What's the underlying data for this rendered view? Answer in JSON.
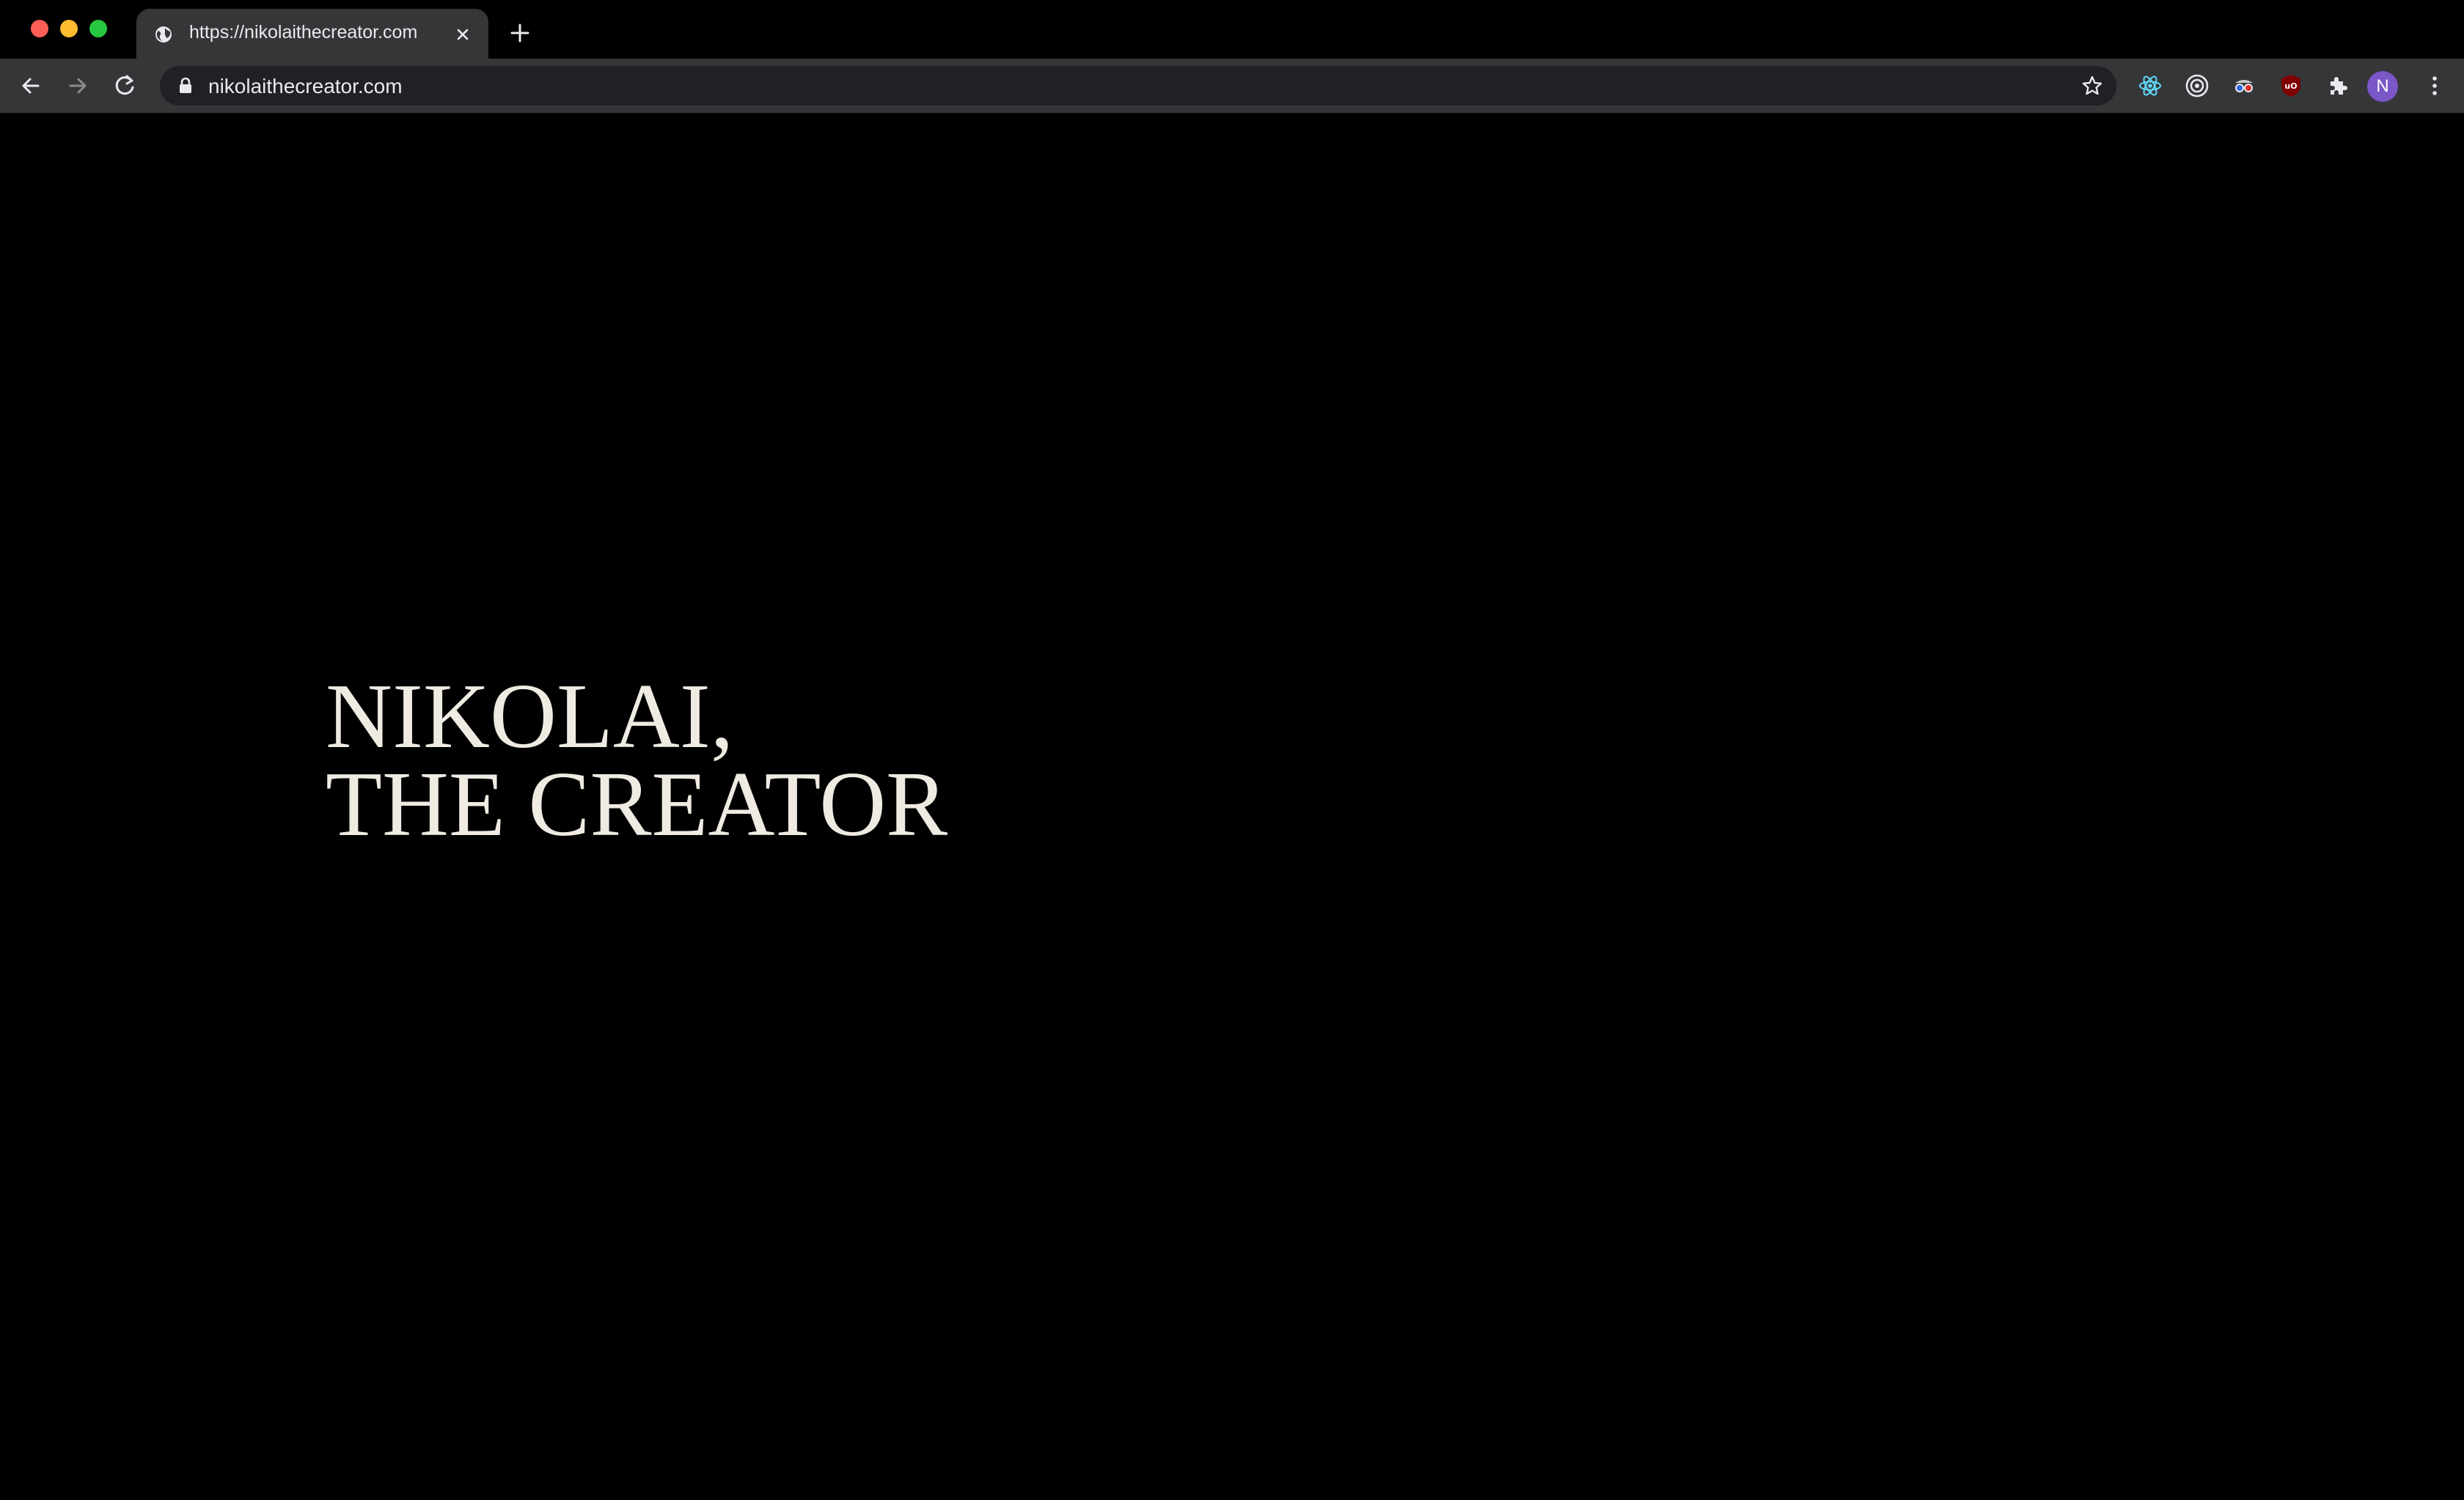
{
  "browser": {
    "tab": {
      "title": "https://nikolaithecreator.com"
    },
    "omnibox": {
      "url": "nikolaithecreator.com"
    },
    "profile": {
      "initial": "N",
      "color": "#7b57c8"
    },
    "extensions": [
      "react-devtools-icon",
      "target-icon",
      "spy-icon",
      "ublock-icon",
      "puzzle-icon"
    ]
  },
  "page": {
    "hero_line1": "NIKOLAI,",
    "hero_line2": "THE CREATOR",
    "text_color": "#efebe2",
    "background": "#000000"
  }
}
